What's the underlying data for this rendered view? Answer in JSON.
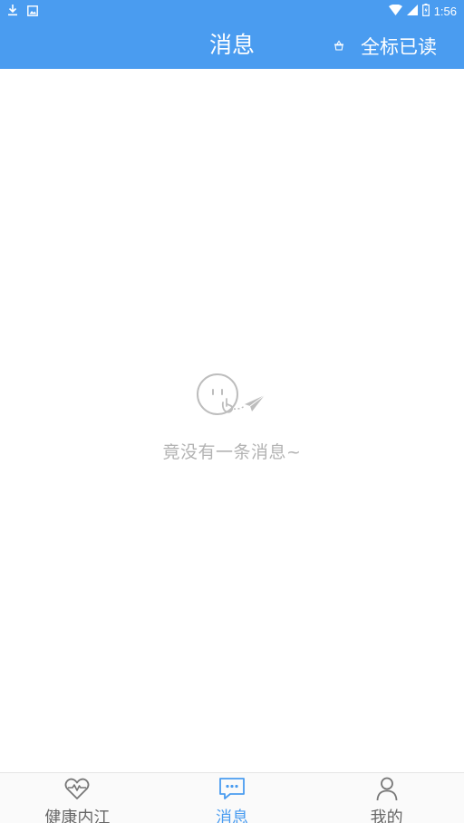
{
  "status_bar": {
    "time": "1:56",
    "left_icons": [
      "download-icon",
      "image-icon"
    ],
    "right_icons": [
      "wifi-icon",
      "cellular-signal-icon",
      "battery-icon"
    ]
  },
  "header": {
    "title": "消息",
    "mark_all_read_label": "全标已读",
    "mark_all_read_icon": "basket-icon"
  },
  "empty_state": {
    "icon": "shh-face-paper-plane-icon",
    "text": "竟没有一条消息~"
  },
  "bottom_nav": {
    "items": [
      {
        "label": "健康内江",
        "icon": "heart-pulse-icon",
        "active": false
      },
      {
        "label": "消息",
        "icon": "chat-bubble-icon",
        "active": true
      },
      {
        "label": "我的",
        "icon": "person-icon",
        "active": false
      }
    ]
  },
  "colors": {
    "primary": "#4a9cf0",
    "muted_text": "#b3b3b3",
    "nav_text": "#666666"
  }
}
